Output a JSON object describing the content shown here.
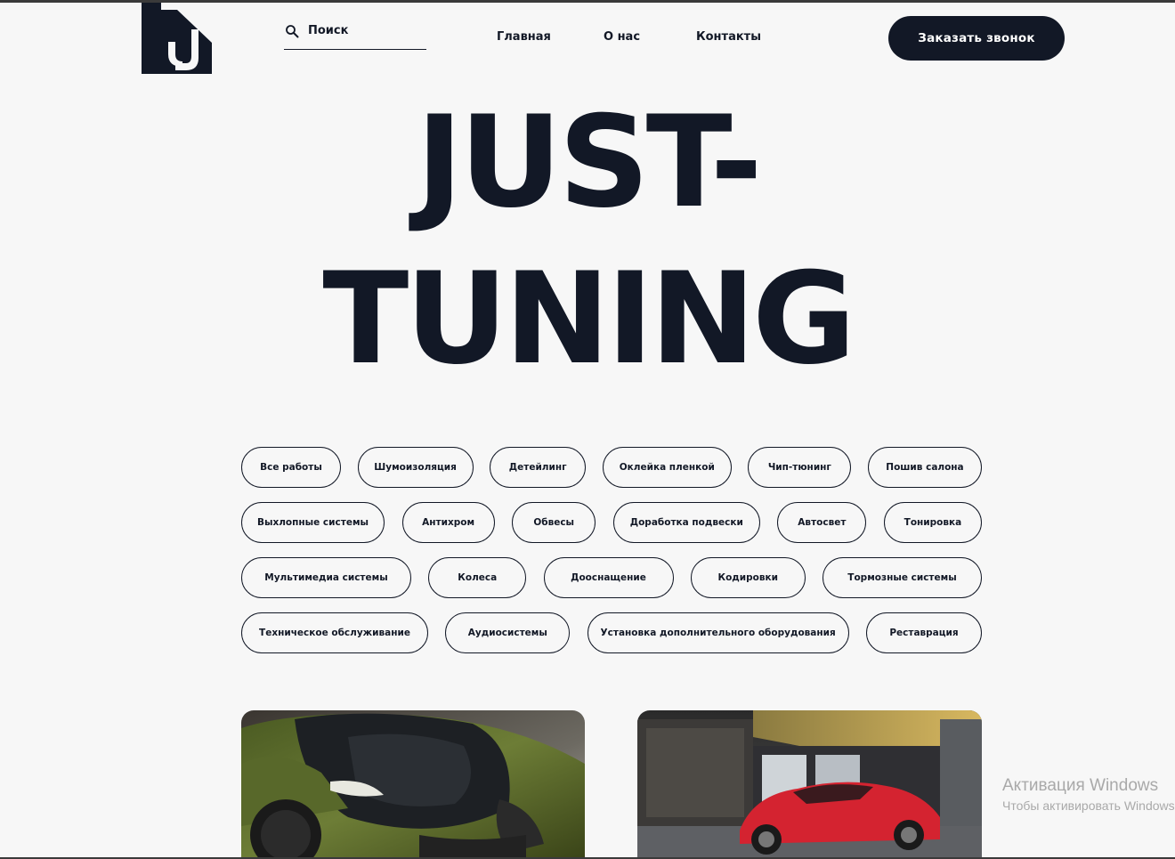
{
  "header": {
    "search": {
      "placeholder": "Поиск"
    },
    "nav": [
      {
        "label": "Главная"
      },
      {
        "label": "О нас"
      },
      {
        "label": "Контакты"
      }
    ],
    "cta_label": "Заказать звонок"
  },
  "hero": {
    "line1": "JUST-",
    "line2": "TUNING"
  },
  "categories": [
    [
      "Все работы",
      "Шумоизоляция",
      "Детейлинг",
      "Оклейка пленкой",
      "Чип-тюнинг",
      "Пошив салона"
    ],
    [
      "Выхлопные системы",
      "Антихром",
      "Обвесы",
      "Доработка подвески",
      "Автосвет",
      "Тонировка"
    ],
    [
      "Мультимедиа системы",
      "Колеса",
      "Дооснащение",
      "Кодировки",
      "Тормозные системы"
    ],
    [
      "Техническое обслуживание",
      "Аудиосистемы",
      "Установка дополнительного оборудования",
      "Реставрация"
    ]
  ],
  "watermark": {
    "title": "Активация Windows",
    "subtitle": "Чтобы активировать Windows"
  },
  "colors": {
    "primary": "#121826",
    "background": "#f7f7f7",
    "car1": "#5a6b2a",
    "car2": "#d42330"
  },
  "icons": [
    "logo-mark",
    "search-icon"
  ]
}
